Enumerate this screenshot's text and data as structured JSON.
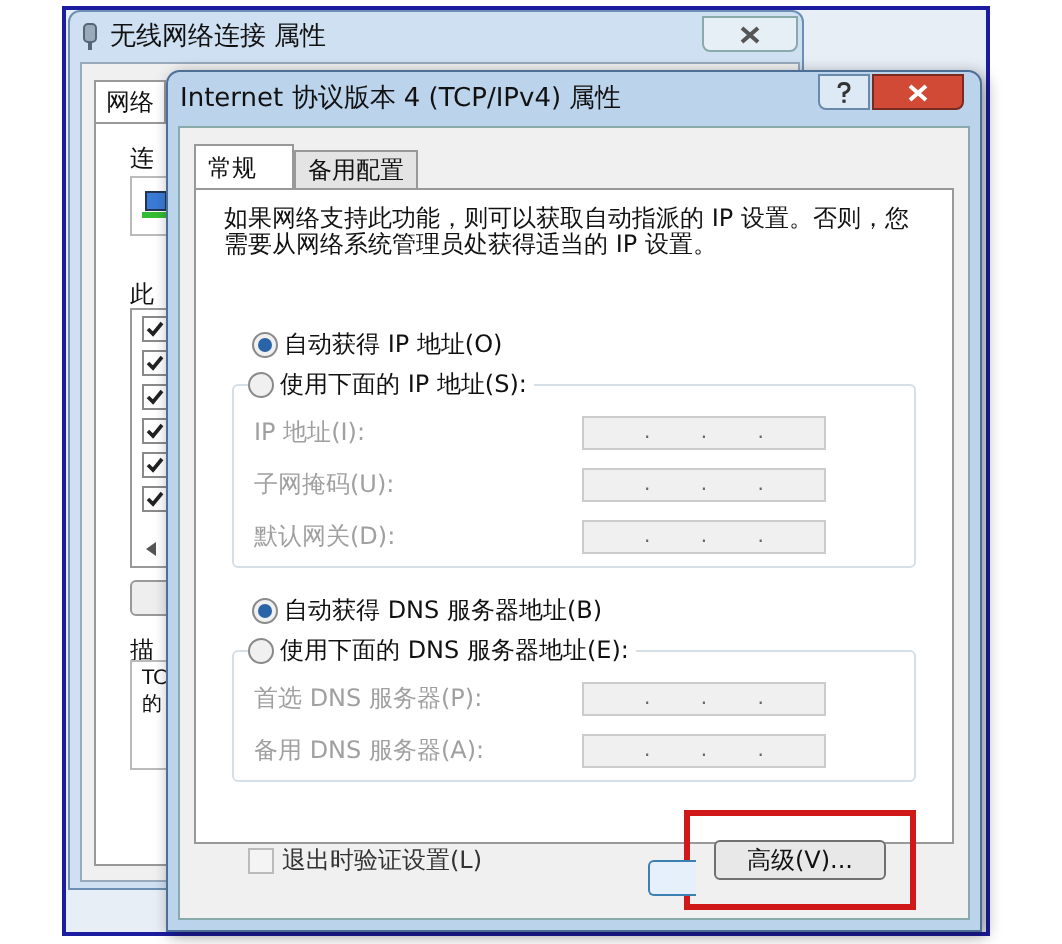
{
  "background_window": {
    "title": "无线网络连接 属性",
    "tabs": [
      {
        "label": "网络",
        "selected": true
      }
    ],
    "connect_label": "连",
    "items_label": "此",
    "items": [
      {
        "checked": true
      },
      {
        "checked": true
      },
      {
        "checked": true
      },
      {
        "checked": true
      },
      {
        "checked": true
      },
      {
        "checked": true
      }
    ],
    "description_label": "描",
    "description": [
      "TC",
      "的"
    ]
  },
  "window": {
    "title": "Internet 协议版本 4 (TCP/IPv4) 属性",
    "tabs": [
      {
        "label": "常规",
        "selected": true
      },
      {
        "label": "备用配置",
        "selected": false
      }
    ],
    "intro": "如果网络支持此功能，则可以获取自动指派的 IP 设置。否则，您需要从网络系统管理员处获得适当的 IP 设置。",
    "ip_options": [
      {
        "label": "自动获得 IP 地址(O)",
        "selected": true
      },
      {
        "label": "使用下面的 IP 地址(S):",
        "selected": false
      }
    ],
    "ip_fields": [
      {
        "label": "IP 地址(I):",
        "value": ". . .",
        "disabled": true
      },
      {
        "label": "子网掩码(U):",
        "value": ". . .",
        "disabled": true
      },
      {
        "label": "默认网关(D):",
        "value": ". . .",
        "disabled": true
      }
    ],
    "dns_options": [
      {
        "label": "自动获得 DNS 服务器地址(B)",
        "selected": true
      },
      {
        "label": "使用下面的 DNS 服务器地址(E):",
        "selected": false
      }
    ],
    "dns_fields": [
      {
        "label": "首选 DNS 服务器(P):",
        "value": ". . .",
        "disabled": true
      },
      {
        "label": "备用 DNS 服务器(A):",
        "value": ". . .",
        "disabled": true
      }
    ],
    "validate_checkbox": {
      "label": "退出时验证设置(L)",
      "checked": false
    },
    "advanced_button": {
      "label": "高级(V)...",
      "highlighted": true
    }
  }
}
